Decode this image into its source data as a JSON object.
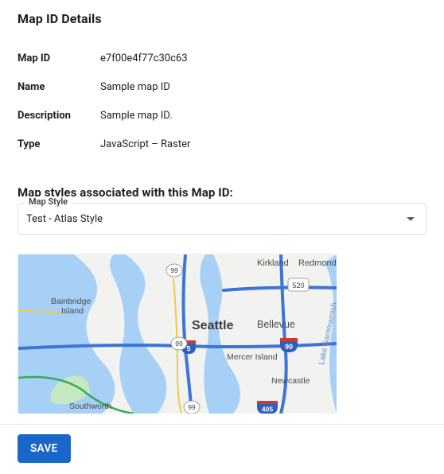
{
  "details": {
    "title": "Map ID Details",
    "rows": [
      {
        "key": "Map ID",
        "value": "e7f00e4f77c30c63"
      },
      {
        "key": "Name",
        "value": "Sample map ID"
      },
      {
        "key": "Description",
        "value": "Sample map ID."
      },
      {
        "key": "Type",
        "value": "JavaScript – Raster"
      }
    ]
  },
  "styles": {
    "heading": "Map styles associated with this Map ID:",
    "label": "Map Style",
    "selected": "Test - Atlas Style"
  },
  "map_preview": {
    "labels": {
      "kirkland": "Kirkland",
      "redmond": "Redmond",
      "bainbridge1": "Bainbridge",
      "bainbridge2": "Island",
      "seattle": "Seattle",
      "bellevue": "Bellevue",
      "mercer": "Mercer Island",
      "newcastle": "Newcastle",
      "southworth": "Southworth",
      "sammamish": "Lake Sammamish"
    },
    "shields": {
      "s99": "99",
      "s520": "520",
      "s90": "90",
      "s5": "5",
      "s405": "405"
    }
  },
  "footer": {
    "save": "SAVE"
  }
}
